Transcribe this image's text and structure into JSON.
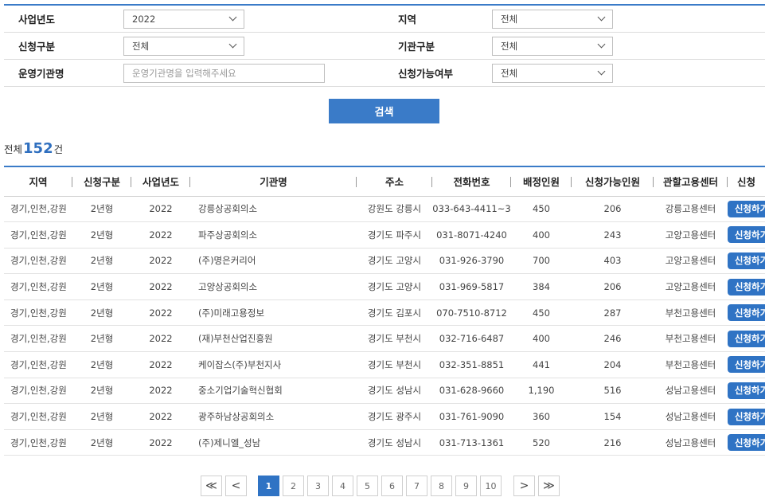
{
  "form": {
    "business_year": {
      "label": "사업년도",
      "value": "2022"
    },
    "region": {
      "label": "지역",
      "value": "전체"
    },
    "apply_type": {
      "label": "신청구분",
      "value": "전체"
    },
    "agency_type": {
      "label": "기관구분",
      "value": "전체"
    },
    "org_name": {
      "label": "운영기관명",
      "placeholder": "운영기관명을 입력해주세요"
    },
    "available": {
      "label": "신청가능여부",
      "value": "전체"
    }
  },
  "search_button": "검색",
  "total": {
    "prefix": "전체",
    "count": "152",
    "suffix": "건"
  },
  "table": {
    "headers": [
      "지역",
      "신청구분",
      "사업년도",
      "기관명",
      "주소",
      "전화번호",
      "배정인원",
      "신청가능인원",
      "관할고용센터",
      "신청"
    ],
    "apply_label": "신청하기",
    "rows": [
      [
        "경기,인천,강원",
        "2년형",
        "2022",
        "강릉상공회의소",
        "강원도 강릉시",
        "033-643-4411~3",
        "450",
        "206",
        "강릉고용센터"
      ],
      [
        "경기,인천,강원",
        "2년형",
        "2022",
        "파주상공회의소",
        "경기도 파주시",
        "031-8071-4240",
        "400",
        "243",
        "고양고용센터"
      ],
      [
        "경기,인천,강원",
        "2년형",
        "2022",
        "(주)명은커리어",
        "경기도 고양시",
        "031-926-3790",
        "700",
        "403",
        "고양고용센터"
      ],
      [
        "경기,인천,강원",
        "2년형",
        "2022",
        "고양상공회의소",
        "경기도 고양시",
        "031-969-5817",
        "384",
        "206",
        "고양고용센터"
      ],
      [
        "경기,인천,강원",
        "2년형",
        "2022",
        "(주)미래고용정보",
        "경기도 김포시",
        "070-7510-8712",
        "450",
        "287",
        "부천고용센터"
      ],
      [
        "경기,인천,강원",
        "2년형",
        "2022",
        "(재)부천산업진흥원",
        "경기도 부천시",
        "032-716-6487",
        "400",
        "246",
        "부천고용센터"
      ],
      [
        "경기,인천,강원",
        "2년형",
        "2022",
        "케이잡스(주)부천지사",
        "경기도 부천시",
        "032-351-8851",
        "441",
        "204",
        "부천고용센터"
      ],
      [
        "경기,인천,강원",
        "2년형",
        "2022",
        "중소기업기술혁신협회",
        "경기도 성남시",
        "031-628-9660",
        "1,190",
        "516",
        "성남고용센터"
      ],
      [
        "경기,인천,강원",
        "2년형",
        "2022",
        "광주하남상공회의소",
        "경기도 광주시",
        "031-761-9090",
        "360",
        "154",
        "성남고용센터"
      ],
      [
        "경기,인천,강원",
        "2년형",
        "2022",
        "(주)제니엘_성남",
        "경기도 성남시",
        "031-713-1361",
        "520",
        "216",
        "성남고용센터"
      ]
    ]
  },
  "pagination": {
    "first": "≪",
    "prev": "<",
    "next": ">",
    "last": "≫",
    "pages": [
      "1",
      "2",
      "3",
      "4",
      "5",
      "6",
      "7",
      "8",
      "9",
      "10"
    ],
    "current": "1"
  }
}
